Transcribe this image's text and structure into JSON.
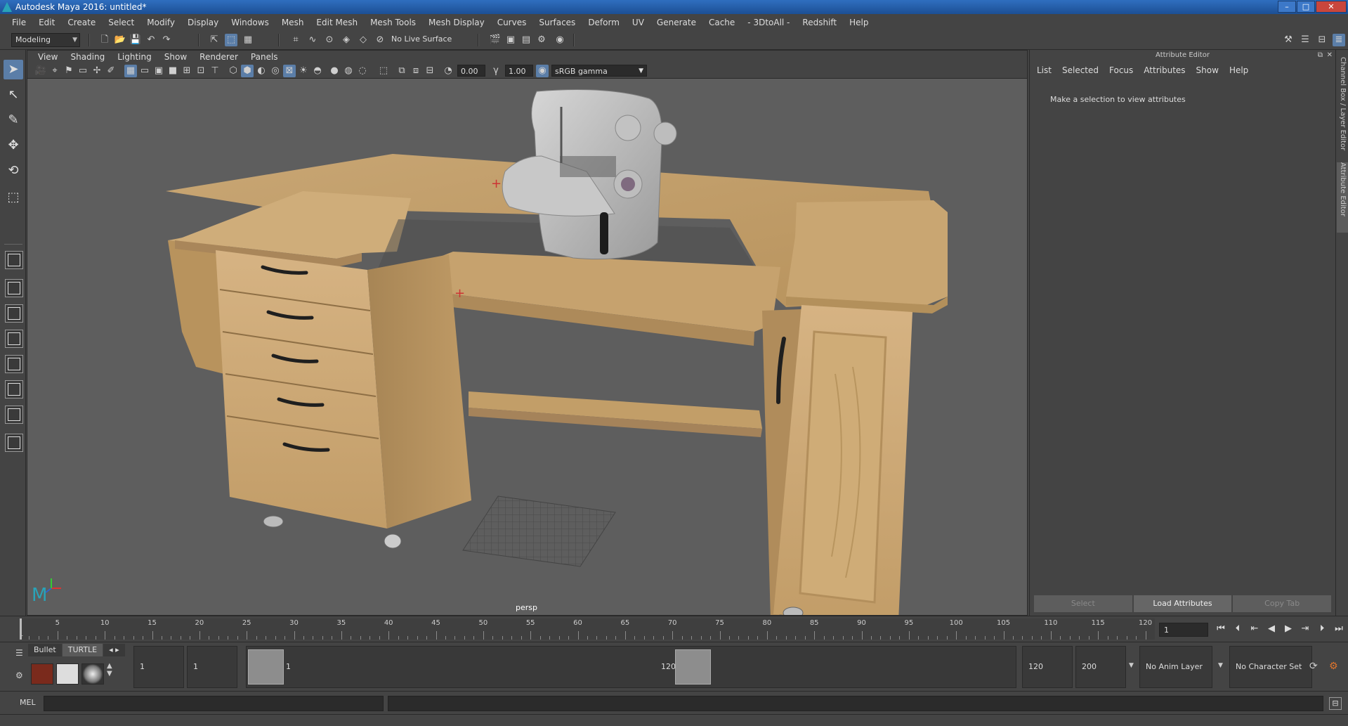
{
  "window": {
    "title": "Autodesk Maya 2016: untitled*",
    "controls": [
      "–",
      "□",
      "✕"
    ]
  },
  "menubar": [
    "File",
    "Edit",
    "Create",
    "Select",
    "Modify",
    "Display",
    "Windows",
    "Mesh",
    "Edit Mesh",
    "Mesh Tools",
    "Mesh Display",
    "Curves",
    "Surfaces",
    "Deform",
    "UV",
    "Generate",
    "Cache",
    "- 3DtoAll -",
    "Redshift",
    "Help"
  ],
  "statusline": {
    "menuset": "Modeling",
    "live_surface": "No Live Surface"
  },
  "viewport": {
    "menu": [
      "View",
      "Shading",
      "Lighting",
      "Show",
      "Renderer",
      "Panels"
    ],
    "field_exposure": "0.00",
    "field_gamma": "1.00",
    "color_space": "sRGB gamma",
    "camera_label": "persp"
  },
  "attribute_editor": {
    "title": "Attribute Editor",
    "menu": [
      "List",
      "Selected",
      "Focus",
      "Attributes",
      "Show",
      "Help"
    ],
    "message": "Make a selection to view attributes",
    "buttons": [
      "Select",
      "Load Attributes",
      "Copy Tab"
    ]
  },
  "side_tabs": [
    "Channel Box / Layer Editor",
    "Attribute Editor"
  ],
  "timeslider": {
    "labels": [
      "5",
      "10",
      "15",
      "20",
      "25",
      "30",
      "35",
      "40",
      "45",
      "50",
      "55",
      "60",
      "65",
      "70",
      "75",
      "80",
      "85",
      "90",
      "95",
      "100",
      "105",
      "110",
      "115",
      "120"
    ],
    "start_label": "1",
    "end_label": "120",
    "current_frame": "1"
  },
  "range": {
    "start": "1",
    "playback_start": "1",
    "range_start_label": "1",
    "range_end_label": "120",
    "playback_end": "120",
    "end": "200",
    "anim_layer": "No Anim Layer",
    "character_set": "No Character Set"
  },
  "shelf_tabs": [
    "Bullet",
    "TURTLE"
  ],
  "cmdline": {
    "label": "MEL"
  },
  "colors": {
    "accent": "#5b7ea8",
    "viewport_bg": "#5e5e5e",
    "wood": "#c9a775"
  },
  "icons": [
    "select-icon",
    "lasso-icon",
    "paint-icon",
    "move-icon",
    "rotate-icon",
    "scale-icon",
    "maya-logo-icon"
  ]
}
